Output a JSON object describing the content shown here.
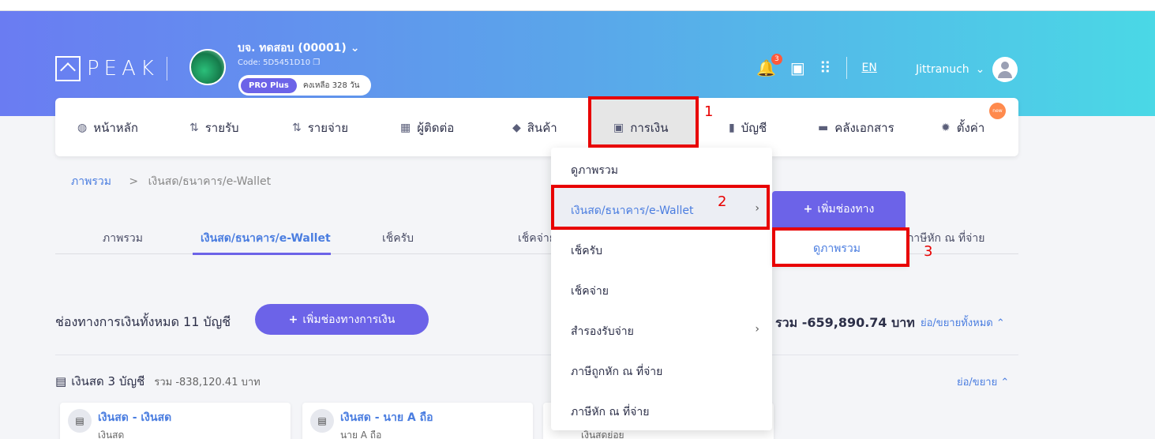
{
  "header": {
    "logo_text": "PEAK",
    "company_name": "บจ. ทดสอบ (00001)",
    "company_code": "Code: 5D5451D10",
    "plan_badge": "PRO Plus",
    "plan_days": "คงเหลือ 328 วัน",
    "notification_count": "3",
    "language": "EN",
    "username": "Jittranuch"
  },
  "nav": {
    "items": [
      {
        "label": "หน้าหลัก",
        "icon": "dashboard-icon"
      },
      {
        "label": "รายรับ",
        "icon": "income-icon"
      },
      {
        "label": "รายจ่าย",
        "icon": "expense-icon"
      },
      {
        "label": "ผู้ติดต่อ",
        "icon": "contacts-icon"
      },
      {
        "label": "สินค้า",
        "icon": "box-icon"
      },
      {
        "label": "การเงิน",
        "icon": "money-icon"
      },
      {
        "label": "บัญชี",
        "icon": "book-icon"
      },
      {
        "label": "คลังเอกสาร",
        "icon": "folder-icon"
      },
      {
        "label": "ตั้งค่า",
        "icon": "gear-icon"
      }
    ],
    "new_badge": "new"
  },
  "breadcrumb": {
    "root": "ภาพรวม",
    "separator": ">",
    "current": "เงินสด/ธนาคาร/e-Wallet"
  },
  "tabs": [
    "ภาพรวม",
    "เงินสด/ธนาคาร/e-Wallet",
    "เช็ครับ",
    "เช็คจ่าย",
    "ภาษีหัก ณ ที่จ่าย"
  ],
  "section": {
    "title": "ช่องทางการเงินทั้งหมด 11 บัญชี",
    "add_button": "เพิ่มช่องทางการเงิน",
    "total": "รวม -659,890.74 บาท",
    "collapse_all": "ย่อ/ขยายทั้งหมด"
  },
  "cash_group": {
    "title": "เงินสด 3 บัญชี",
    "subtotal": "รวม -838,120.41 บาท",
    "collapse": "ย่อ/ขยาย",
    "cards": [
      {
        "name": "เงินสด - เงินสด",
        "sub": "เงินสด"
      },
      {
        "name": "เงินสด - นาย A ถือ",
        "sub": "นาย A ถือ"
      },
      {
        "name": "",
        "sub": "เงินสดย่อย"
      }
    ]
  },
  "dropdown": {
    "items": [
      {
        "label": "ดูภาพรวม"
      },
      {
        "label": "เงินสด/ธนาคาร/e-Wallet"
      },
      {
        "label": "เช็ครับ"
      },
      {
        "label": "เช็คจ่าย"
      },
      {
        "label": "สำรองรับจ่าย"
      },
      {
        "label": "ภาษีถูกหัก ณ ที่จ่าย"
      },
      {
        "label": "ภาษีหัก ณ ที่จ่าย"
      }
    ]
  },
  "submenu": {
    "add_button": "เพิ่มช่องทาง",
    "overview": "ดูภาพรวม"
  },
  "annotations": {
    "marker_1": "1",
    "marker_2": "2",
    "marker_3": "3",
    "color": "#e80000"
  }
}
